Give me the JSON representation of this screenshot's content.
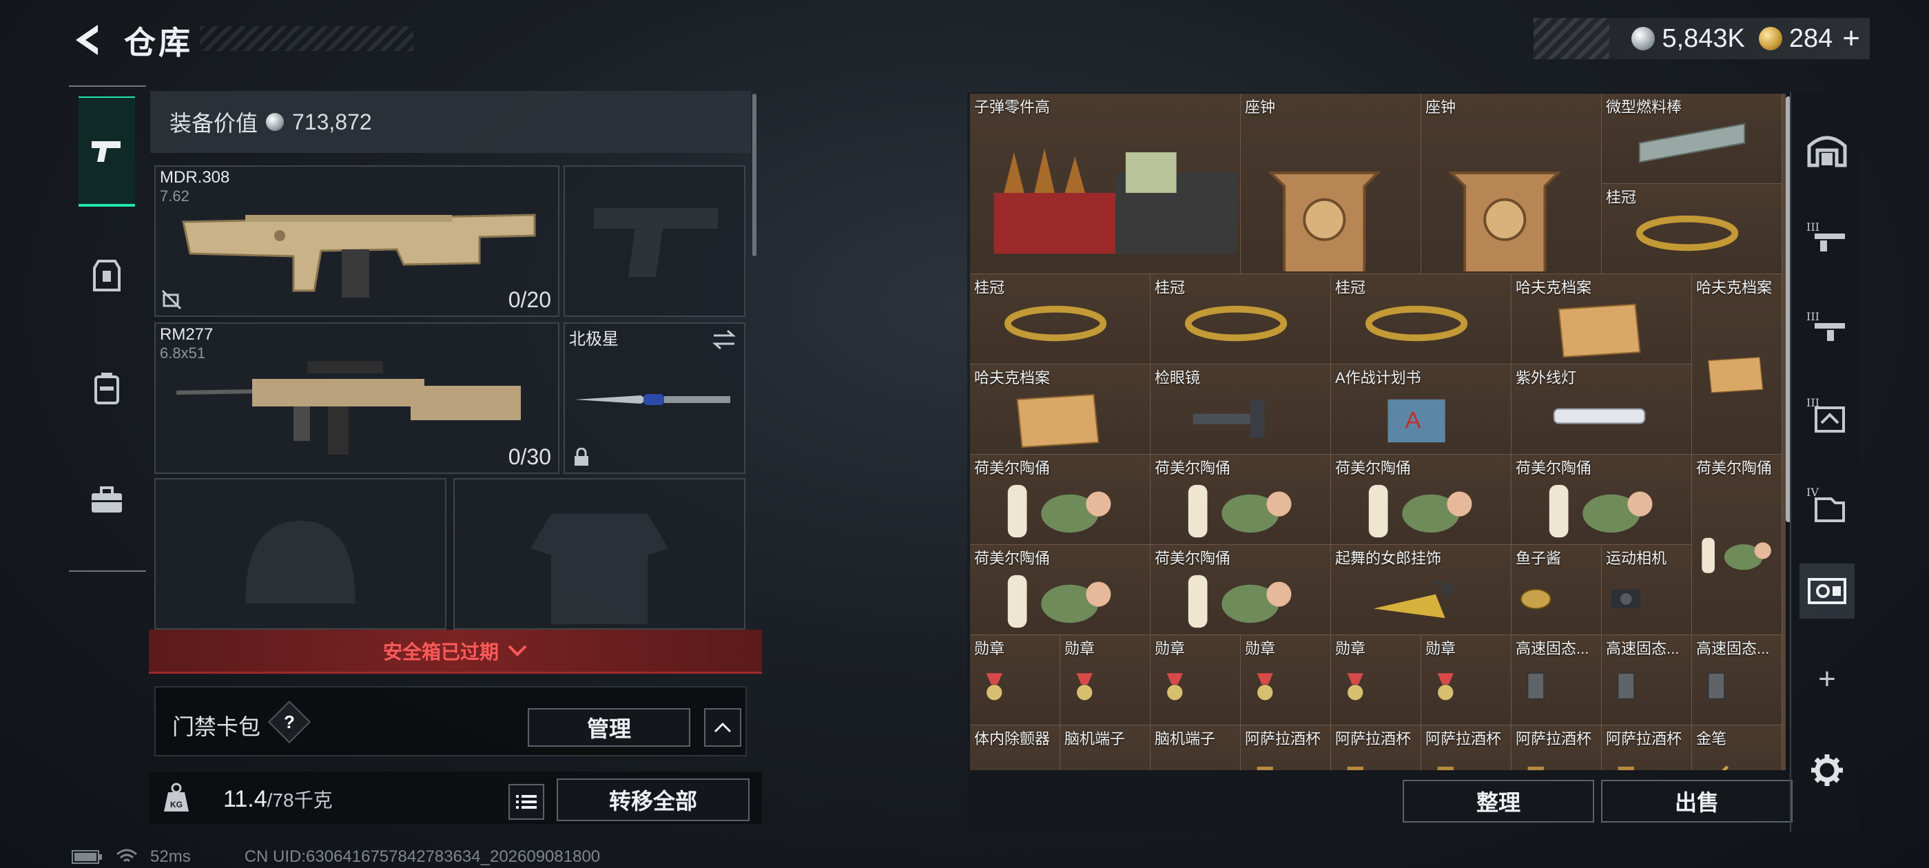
{
  "header": {
    "title": "仓库",
    "currency_silver": "5,843K",
    "currency_gold": "284",
    "add_symbol": "+"
  },
  "loadout": {
    "value_label": "装备价值",
    "value": "713,872",
    "primary": {
      "name": "MDR.308",
      "caliber": "7.62",
      "ammo": "0/20"
    },
    "pistol": {
      "name": ""
    },
    "secondary": {
      "name": "RM277",
      "caliber": "6.8x51",
      "ammo": "0/30"
    },
    "melee": {
      "name": "北极星"
    }
  },
  "safebox": {
    "expired_text": "安全箱已过期"
  },
  "keycard": {
    "label": "门禁卡包",
    "help": "?",
    "manage_label": "管理"
  },
  "footer": {
    "weight": "11.4",
    "weight_max": "/78千克",
    "transfer_all": "转移全部"
  },
  "status": {
    "ping": "52ms",
    "uid": "CN UID:6306416757842783634_202609081800"
  },
  "stash": {
    "items": [
      {
        "label": "子弹零件高",
        "icon": "ammo-parts-icon"
      },
      {
        "label": "座钟",
        "icon": "clock-icon"
      },
      {
        "label": "座钟",
        "icon": "clock-icon"
      },
      {
        "label": "微型燃料棒",
        "icon": "fuel-rod-icon"
      },
      {
        "label": "桂冠",
        "icon": "laurel-icon"
      },
      {
        "label": "桂冠",
        "icon": "laurel-icon"
      },
      {
        "label": "桂冠",
        "icon": "laurel-icon"
      },
      {
        "label": "桂冠",
        "icon": "laurel-icon"
      },
      {
        "label": "哈夫克档案",
        "icon": "dossier-icon"
      },
      {
        "label": "哈夫克档案",
        "icon": "dossier-icon"
      },
      {
        "label": "哈夫克档案",
        "icon": "dossier-icon"
      },
      {
        "label": "检眼镜",
        "icon": "ophthalmoscope-icon"
      },
      {
        "label": "A作战计划书",
        "icon": "plan-book-icon"
      },
      {
        "label": "紫外线灯",
        "icon": "uv-lamp-icon"
      },
      {
        "label": "荷美尔陶俑",
        "icon": "figurine-icon"
      },
      {
        "label": "荷美尔陶俑",
        "icon": "figurine-icon"
      },
      {
        "label": "荷美尔陶俑",
        "icon": "figurine-icon"
      },
      {
        "label": "荷美尔陶俑",
        "icon": "figurine-icon"
      },
      {
        "label": "荷美尔陶俑",
        "icon": "figurine-icon"
      },
      {
        "label": "荷美尔陶俑",
        "icon": "figurine-icon"
      },
      {
        "label": "荷美尔陶俑",
        "icon": "figurine-icon"
      },
      {
        "label": "起舞的女郎挂饰",
        "icon": "dancer-ornament-icon"
      },
      {
        "label": "鱼子酱",
        "icon": "caviar-icon"
      },
      {
        "label": "运动相机",
        "icon": "camera-icon"
      },
      {
        "label": "勋章",
        "icon": "medal-icon"
      },
      {
        "label": "勋章",
        "icon": "medal-icon"
      },
      {
        "label": "勋章",
        "icon": "medal-icon"
      },
      {
        "label": "勋章",
        "icon": "medal-icon"
      },
      {
        "label": "勋章",
        "icon": "medal-icon"
      },
      {
        "label": "勋章",
        "icon": "medal-icon"
      },
      {
        "label": "高速固态...",
        "icon": "ssd-icon"
      },
      {
        "label": "高速固态...",
        "icon": "ssd-icon"
      },
      {
        "label": "高速固态...",
        "icon": "ssd-icon"
      },
      {
        "label": "体内除颤器",
        "icon": "defibrillator-icon"
      },
      {
        "label": "脑机端子",
        "icon": "bci-icon"
      },
      {
        "label": "脑机端子",
        "icon": "bci-icon"
      },
      {
        "label": "阿萨拉酒杯",
        "icon": "goblet-icon"
      },
      {
        "label": "阿萨拉酒杯",
        "icon": "goblet-icon"
      },
      {
        "label": "阿萨拉酒杯",
        "icon": "goblet-icon"
      },
      {
        "label": "阿萨拉酒杯",
        "icon": "goblet-icon"
      },
      {
        "label": "阿萨拉酒杯",
        "icon": "goblet-icon"
      },
      {
        "label": "金笔",
        "icon": "gold-pen-icon"
      }
    ],
    "sort_label": "整理",
    "sell_label": "出售",
    "add_tab": "+"
  },
  "colors": {
    "accent": "#1fe3b0",
    "danger": "#ff5a5a",
    "cell_bg": "#4a3a2e"
  }
}
